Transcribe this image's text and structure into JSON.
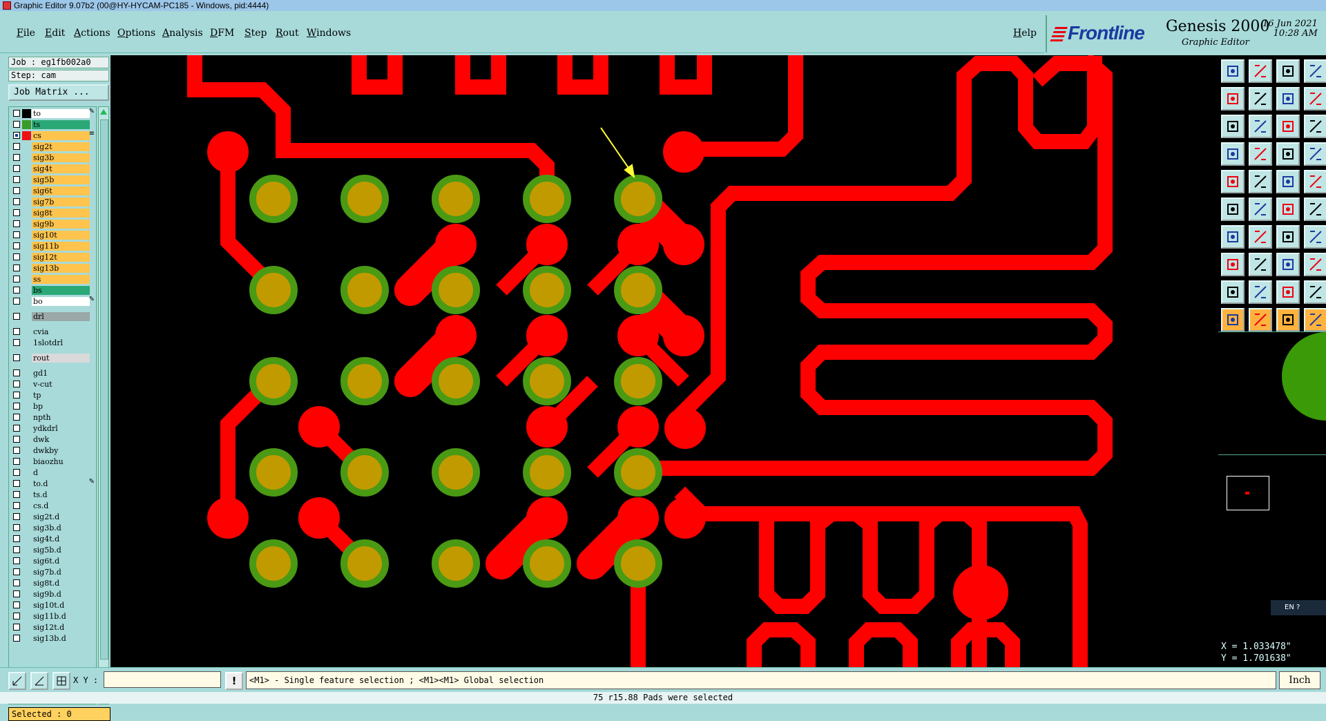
{
  "window": {
    "title": "Graphic Editor 9.07b2 (00@HY-HYCAM-PC185 - Windows, pid:4444)"
  },
  "menu": [
    "File",
    "Edit",
    "Actions",
    "Options",
    "Analysis",
    "DFM",
    "Step",
    "Rout",
    "Windows"
  ],
  "help": "Help",
  "brand": {
    "logo": "Frontline",
    "product": "Genesis 2000",
    "subtitle": "Graphic Editor",
    "date": "16 Jun 2021",
    "time": "10:28 AM"
  },
  "job": {
    "job_label": "Job : eg1fb002a0",
    "step_label": "Step: cam",
    "matrix_button": "Job Matrix ..."
  },
  "layers": [
    {
      "name": "to",
      "color": "#ffffff",
      "swatch": "#000000",
      "checked": false,
      "mark": "✎"
    },
    {
      "name": "ts",
      "color": "#2aa876",
      "swatch": "#3a9a2a",
      "checked": false
    },
    {
      "name": "cs",
      "color": "#ffc44d",
      "swatch": "#ee1111",
      "checked": true,
      "mark": "≡"
    },
    {
      "name": "sig2t",
      "color": "#ffc44d",
      "checked": false
    },
    {
      "name": "sig3b",
      "color": "#ffc44d",
      "checked": false
    },
    {
      "name": "sig4t",
      "color": "#ffc44d",
      "checked": false
    },
    {
      "name": "sig5b",
      "color": "#ffc44d",
      "checked": false
    },
    {
      "name": "sig6t",
      "color": "#ffc44d",
      "checked": false
    },
    {
      "name": "sig7b",
      "color": "#ffc44d",
      "checked": false
    },
    {
      "name": "sig8t",
      "color": "#ffc44d",
      "checked": false
    },
    {
      "name": "sig9b",
      "color": "#ffc44d",
      "checked": false
    },
    {
      "name": "sig10t",
      "color": "#ffc44d",
      "checked": false
    },
    {
      "name": "sig11b",
      "color": "#ffc44d",
      "checked": false
    },
    {
      "name": "sig12t",
      "color": "#ffc44d",
      "checked": false
    },
    {
      "name": "sig13b",
      "color": "#ffc44d",
      "checked": false
    },
    {
      "name": "ss",
      "color": "#ffc44d",
      "checked": false
    },
    {
      "name": "bs",
      "color": "#2aa876",
      "checked": false
    },
    {
      "name": "bo",
      "color": "#ffffff",
      "checked": false,
      "mark": "✎"
    },
    {
      "name": "drl",
      "color": "#9aa8a8",
      "checked": false,
      "gap": true
    },
    {
      "name": "cvia",
      "color": "#a8dada",
      "checked": false,
      "gap": true
    },
    {
      "name": "1slotdrl",
      "color": "#a8dada",
      "checked": false
    },
    {
      "name": "rout",
      "color": "#d9d9d9",
      "checked": false,
      "gap": true
    },
    {
      "name": "gd1",
      "color": "#a8dada",
      "checked": false,
      "gap": true
    },
    {
      "name": "v-cut",
      "color": "#a8dada",
      "checked": false
    },
    {
      "name": "tp",
      "color": "#a8dada",
      "checked": false
    },
    {
      "name": "bp",
      "color": "#a8dada",
      "checked": false
    },
    {
      "name": "npth",
      "color": "#a8dada",
      "checked": false
    },
    {
      "name": "ydkdrl",
      "color": "#a8dada",
      "checked": false
    },
    {
      "name": "dwk",
      "color": "#a8dada",
      "checked": false
    },
    {
      "name": "dwkby",
      "color": "#a8dada",
      "checked": false
    },
    {
      "name": "biaozhu",
      "color": "#a8dada",
      "checked": false
    },
    {
      "name": "d",
      "color": "#a8dada",
      "checked": false
    },
    {
      "name": "to.d",
      "color": "#a8dada",
      "checked": false,
      "mark": "✎"
    },
    {
      "name": "ts.d",
      "color": "#a8dada",
      "checked": false
    },
    {
      "name": "cs.d",
      "color": "#a8dada",
      "checked": false
    },
    {
      "name": "sig2t.d",
      "color": "#a8dada",
      "checked": false
    },
    {
      "name": "sig3b.d",
      "color": "#a8dada",
      "checked": false
    },
    {
      "name": "sig4t.d",
      "color": "#a8dada",
      "checked": false
    },
    {
      "name": "sig5b.d",
      "color": "#a8dada",
      "checked": false
    },
    {
      "name": "sig6t.d",
      "color": "#a8dada",
      "checked": false
    },
    {
      "name": "sig7b.d",
      "color": "#a8dada",
      "checked": false
    },
    {
      "name": "sig8t.d",
      "color": "#a8dada",
      "checked": false
    },
    {
      "name": "sig9b.d",
      "color": "#a8dada",
      "checked": false
    },
    {
      "name": "sig10t.d",
      "color": "#a8dada",
      "checked": false
    },
    {
      "name": "sig11b.d",
      "color": "#a8dada",
      "checked": false
    },
    {
      "name": "sig12t.d",
      "color": "#a8dada",
      "checked": false
    },
    {
      "name": "sig13b.d",
      "color": "#a8dada",
      "checked": false
    }
  ],
  "selected": "Selected : 0",
  "coords": {
    "x": "X = 1.033478\"",
    "y": "Y = 1.701638\""
  },
  "ime": "EN",
  "bottom": {
    "xy_label": "X Y :",
    "xy_value": "",
    "warn": "!",
    "message": "<M1> - Single feature selection ; <M1><M1> Global selection",
    "unit": "Inch"
  },
  "status": "75 r15.88 Pads were selected",
  "colors": {
    "trace": "#ff0000",
    "pad": "#c19a00",
    "pad_ring": "#4a9a14",
    "canvas": "#000000",
    "panel": "#a8dada"
  }
}
